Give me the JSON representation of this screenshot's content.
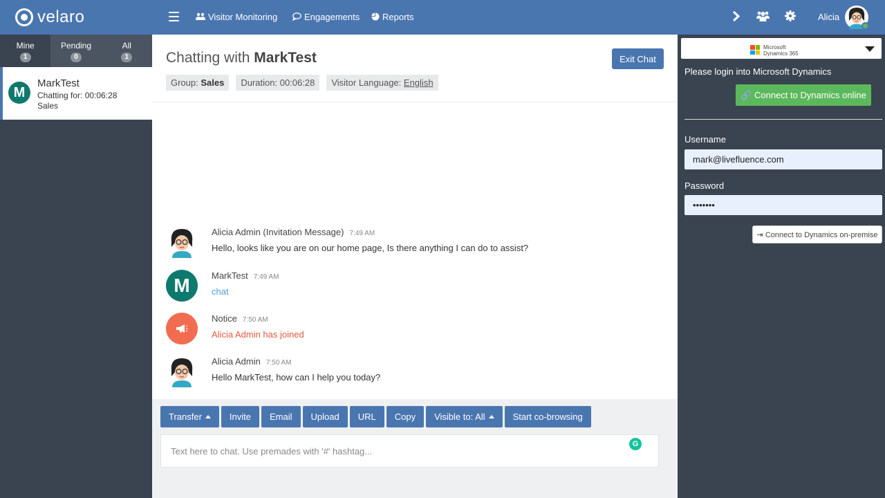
{
  "brand": {
    "name": "velaro"
  },
  "nav": {
    "items": [
      {
        "label": "Visitor Monitoring",
        "icon": "users-icon"
      },
      {
        "label": "Engagements",
        "icon": "chat-bubble-icon"
      },
      {
        "label": "Reports",
        "icon": "pie-chart-icon"
      }
    ]
  },
  "user": {
    "name": "Alicia",
    "status": "online"
  },
  "sidebar": {
    "tabs": [
      {
        "label": "Mine",
        "count": "1"
      },
      {
        "label": "Pending",
        "count": "0"
      },
      {
        "label": "All",
        "count": "1"
      }
    ],
    "chats": [
      {
        "initial": "M",
        "name": "MarkTest",
        "duration": "Chatting for: 00:06:28",
        "group": "Sales"
      }
    ]
  },
  "chat": {
    "title_prefix": "Chatting with",
    "visitor": "MarkTest",
    "exit_label": "Exit Chat",
    "group_label": "Group:",
    "group_value": "Sales",
    "duration": "Duration: 00:06:28",
    "language_label": "Visitor Language:",
    "language_value": "English",
    "messages": [
      {
        "sender": "Alicia Admin (Invitation Message)",
        "time": "7:49 AM",
        "text": "Hello, looks like you are on our home page, Is there anything I can do to assist?",
        "type": "agent"
      },
      {
        "sender": "MarkTest",
        "time": "7:49 AM",
        "text": "chat",
        "type": "visitor",
        "initial": "M"
      },
      {
        "sender": "Notice",
        "time": "7:50 AM",
        "text": "Alicia Admin has joined",
        "type": "notice"
      },
      {
        "sender": "Alicia Admin",
        "time": "7:50 AM",
        "text": "Hello MarkTest, how can I help you today?",
        "type": "agent"
      }
    ]
  },
  "composer": {
    "buttons": {
      "transfer": "Transfer",
      "invite": "Invite",
      "email": "Email",
      "upload": "Upload",
      "url": "URL",
      "copy": "Copy",
      "visible": "Visible to: All",
      "cobrowse": "Start co-browsing"
    },
    "placeholder": "Text here to chat. Use premades with '#' hashtag...",
    "grammarly_letter": "G"
  },
  "crm": {
    "product_line1": "Microsoft",
    "product_line2": "Dynamics 365",
    "login_prompt": "Please login into Microsoft Dynamics",
    "connect_online": "Connect to Dynamics online",
    "username_label": "Username",
    "username_value": "mark@livefluence.com",
    "password_label": "Password",
    "password_value": "•••••••",
    "connect_premise": "Connect to Dynamics on-premise"
  },
  "colors": {
    "header": "#4a76b0",
    "panel": "#3a4350",
    "teal_avatar": "#0e7a6e",
    "notice": "#f26c4f",
    "success": "#5cb85c",
    "link": "#4a9fd5"
  }
}
